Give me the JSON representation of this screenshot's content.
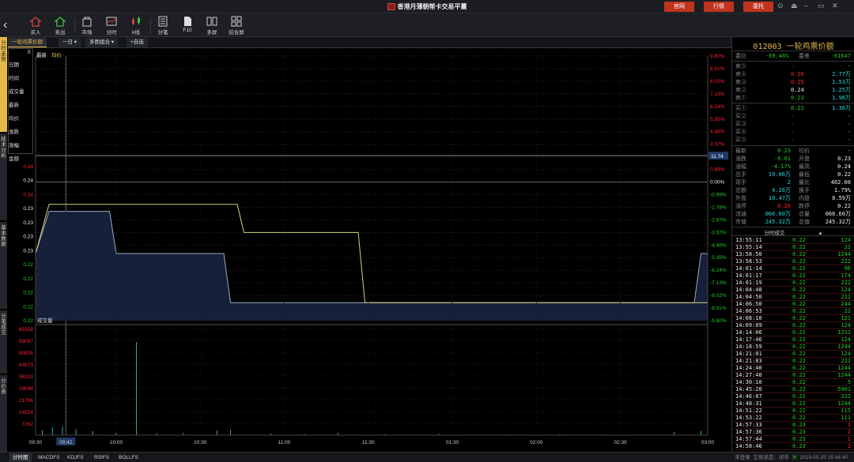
{
  "window": {
    "title": "香港月薄朝帮卡交易平薑",
    "buttons": [
      "官网",
      "行情",
      "委托"
    ],
    "controls": [
      "⊙",
      "⏏",
      "–",
      "▭",
      "✕"
    ]
  },
  "toolbar": {
    "items": [
      {
        "label": "买入",
        "icon": "buy-icon"
      },
      {
        "label": "卖出",
        "icon": "sell-icon"
      },
      {
        "label": "市场",
        "icon": "market-icon"
      },
      {
        "label": "分时",
        "icon": "timeshare-icon"
      },
      {
        "label": "k线",
        "icon": "kline-icon"
      },
      {
        "label": "分笔",
        "icon": "ticks-icon"
      },
      {
        "label": "F10",
        "icon": "f10-icon"
      },
      {
        "label": "多屏",
        "icon": "multiscreen-icon"
      },
      {
        "label": "综合屏",
        "icon": "dashboard-icon"
      }
    ]
  },
  "chart_tabs": {
    "name": "一轮鸡票价额",
    "period": "一日",
    "mode": "多图组合",
    "add": "+自选"
  },
  "side_tabs": [
    "分时走势",
    "技术分析",
    "基本数据",
    "分笔成交",
    "分价表"
  ],
  "overlay": {
    "close": "X",
    "labels": [
      "日期",
      "时间",
      "成交量",
      "最新",
      "均价",
      "涨跌",
      "涨幅",
      "金额"
    ]
  },
  "legend": {
    "latest": "最新",
    "avg": "均价"
  },
  "chart_data": {
    "type": "line",
    "price_ticks": [
      "0.24",
      "0.24",
      "0.24",
      "0.23",
      "0.23",
      "0.23",
      "0.23",
      "0.22",
      "0.22",
      "0.22",
      "0.22",
      "0.22"
    ],
    "pct_ticks": [
      "9.80%",
      "8.91%",
      "8.02%",
      "7.13%",
      "6.24%",
      "5.35%",
      "4.46%",
      "3.57%",
      "1.78%",
      "0.89%",
      "0.00%",
      "-0.89%",
      "-1.78%",
      "-2.67%",
      "-3.57%",
      "-4.46%",
      "-5.35%",
      "-6.24%",
      "-7.13%",
      "-8.02%",
      "-8.91%",
      "-9.80%"
    ],
    "price_marker": "11.74",
    "time_ticks": [
      "09:30",
      "09:42",
      "10:00",
      "10:30",
      "11:00",
      "11:30",
      "01:30",
      "02:00",
      "02:30",
      "03:00"
    ],
    "volume_label": "成交量",
    "volume_ticks": [
      "65358",
      "58097",
      "50835",
      "43573",
      "36310",
      "29048",
      "21786",
      "14524",
      "7262"
    ],
    "price_series": [
      [
        0,
        0.229
      ],
      [
        0.02,
        0.235
      ],
      [
        0.07,
        0.235
      ],
      [
        0.11,
        0.235
      ],
      [
        0.12,
        0.229
      ],
      [
        0.28,
        0.229
      ],
      [
        0.29,
        0.222
      ],
      [
        0.98,
        0.222
      ],
      [
        0.99,
        0.229
      ],
      [
        1,
        0.229
      ]
    ],
    "avg_series": [
      [
        0,
        0.229
      ],
      [
        0.02,
        0.236
      ],
      [
        0.3,
        0.236
      ],
      [
        0.31,
        0.232
      ],
      [
        0.48,
        0.232
      ],
      [
        0.49,
        0.222
      ],
      [
        1,
        0.222
      ]
    ],
    "volume_bars": [
      [
        0.01,
        3000
      ],
      [
        0.025,
        4800
      ],
      [
        0.04,
        5200
      ],
      [
        0.06,
        3600
      ],
      [
        0.085,
        2400
      ],
      [
        0.12,
        1800
      ],
      [
        0.15,
        57000
      ],
      [
        0.18,
        1200
      ],
      [
        0.22,
        1500
      ],
      [
        0.27,
        2800
      ],
      [
        0.29,
        3200
      ],
      [
        0.35,
        900
      ],
      [
        0.4,
        700
      ],
      [
        0.45,
        1600
      ],
      [
        0.52,
        600
      ],
      [
        0.6,
        800
      ],
      [
        0.7,
        500
      ],
      [
        0.78,
        700
      ],
      [
        0.85,
        400
      ],
      [
        0.95,
        1800
      ],
      [
        0.99,
        2600
      ]
    ],
    "ylim": [
      0.22,
      0.245
    ],
    "vol_max": 65358
  },
  "quote": {
    "title": "012003 一轮鸡票价额",
    "wb_label": "委比",
    "wb_value": "-69.46%",
    "wc_label": "委差",
    "wc_value": "-61647",
    "sells": [
      {
        "label": "卖⑤",
        "price": "-",
        "vol": "-"
      },
      {
        "label": "卖④",
        "price": "0.26",
        "vol": "2.77万"
      },
      {
        "label": "卖③",
        "price": "0.25",
        "vol": "1.53万"
      },
      {
        "label": "卖②",
        "price": "0.24",
        "vol": "1.25万"
      },
      {
        "label": "卖①",
        "price": "0.23",
        "vol": "1.96万"
      }
    ],
    "buys": [
      {
        "label": "买①",
        "price": "0.22",
        "vol": "1.36万"
      },
      {
        "label": "买②",
        "price": "-",
        "vol": "-"
      },
      {
        "label": "买③",
        "price": "-",
        "vol": "-"
      },
      {
        "label": "买④",
        "price": "-",
        "vol": "-"
      },
      {
        "label": "买⑤",
        "price": "-",
        "vol": "-"
      }
    ],
    "stats": [
      {
        "l1": "最新",
        "v1": "0.23",
        "l2": "均价",
        "v2": "-"
      },
      {
        "l1": "涨跌",
        "v1": "-0.01",
        "l2": "开盘",
        "v2": "0.23"
      },
      {
        "l1": "涨幅",
        "v1": "-4.17%",
        "l2": "最高",
        "v2": "0.24"
      },
      {
        "l1": "总手",
        "v1": "19.06万",
        "l2": "最低",
        "v2": "0.22"
      },
      {
        "l1": "现手",
        "v1": "2",
        "l2": "量比",
        "v2": "402.00"
      },
      {
        "l1": "总额",
        "v1": "4.26万",
        "l2": "换手",
        "v2": "1.79%"
      },
      {
        "l1": "外盘",
        "v1": "10.47万",
        "l2": "内盘",
        "v2": "8.59万"
      },
      {
        "l1": "涨停",
        "v1": "0.26",
        "l2": "跌停",
        "v2": "0.22"
      },
      {
        "l1": "流通",
        "v1": "066.60万",
        "l2": "总量",
        "v2": "066.60万"
      },
      {
        "l1": "市值",
        "v1": "245.32万",
        "l2": "总值",
        "v2": "245.32万"
      }
    ],
    "ticks_label": "分时成交",
    "ticks": [
      [
        "13:55:11",
        "0.22",
        "124"
      ],
      [
        "13:55:14",
        "0.22",
        "22"
      ],
      [
        "13:58:50",
        "0.22",
        "1244"
      ],
      [
        "13:58:53",
        "0.22",
        "222"
      ],
      [
        "14:01:14",
        "0.22",
        "96"
      ],
      [
        "14:01:17",
        "0.22",
        "174"
      ],
      [
        "14:01:19",
        "0.22",
        "222"
      ],
      [
        "14:04:48",
        "0.22",
        "124"
      ],
      [
        "14:04:50",
        "0.22",
        "222"
      ],
      [
        "14:06:50",
        "0.22",
        "244"
      ],
      [
        "14:06:53",
        "0.22",
        "22"
      ],
      [
        "14:08:10",
        "0.22",
        "121"
      ],
      [
        "14:09:09",
        "0.22",
        "124"
      ],
      [
        "14:14:06",
        "0.22",
        "1211"
      ],
      [
        "14:17:46",
        "0.22",
        "124"
      ],
      [
        "14:18:59",
        "0.22",
        "1244"
      ],
      [
        "14:21:01",
        "0.22",
        "124"
      ],
      [
        "14:21:03",
        "0.22",
        "222"
      ],
      [
        "14:24:40",
        "0.22",
        "1244"
      ],
      [
        "14:27:40",
        "0.22",
        "1244"
      ],
      [
        "14:30:10",
        "0.22",
        "5"
      ],
      [
        "14:45:20",
        "0.22",
        "5901"
      ],
      [
        "14:46:07",
        "0.22",
        "222"
      ],
      [
        "14:48:31",
        "0.22",
        "1244"
      ],
      [
        "14:51:22",
        "0.22",
        "115"
      ],
      [
        "14:53:22",
        "0.22",
        "111"
      ],
      [
        "14:57:33",
        "0.23",
        "1"
      ],
      [
        "14:57:36",
        "0.23",
        "2"
      ],
      [
        "14:57:44",
        "0.23",
        "1"
      ],
      [
        "14:58:46",
        "0.23",
        "2"
      ]
    ]
  },
  "bottom_tabs": [
    "分时图",
    "MACDFS",
    "KDJFS",
    "RSIFS",
    "BOLLFS"
  ],
  "status": {
    "text1": "未登录",
    "text2": "交易状态：",
    "text3": "闭市",
    "time": "2019-05-25 15:44:40"
  }
}
